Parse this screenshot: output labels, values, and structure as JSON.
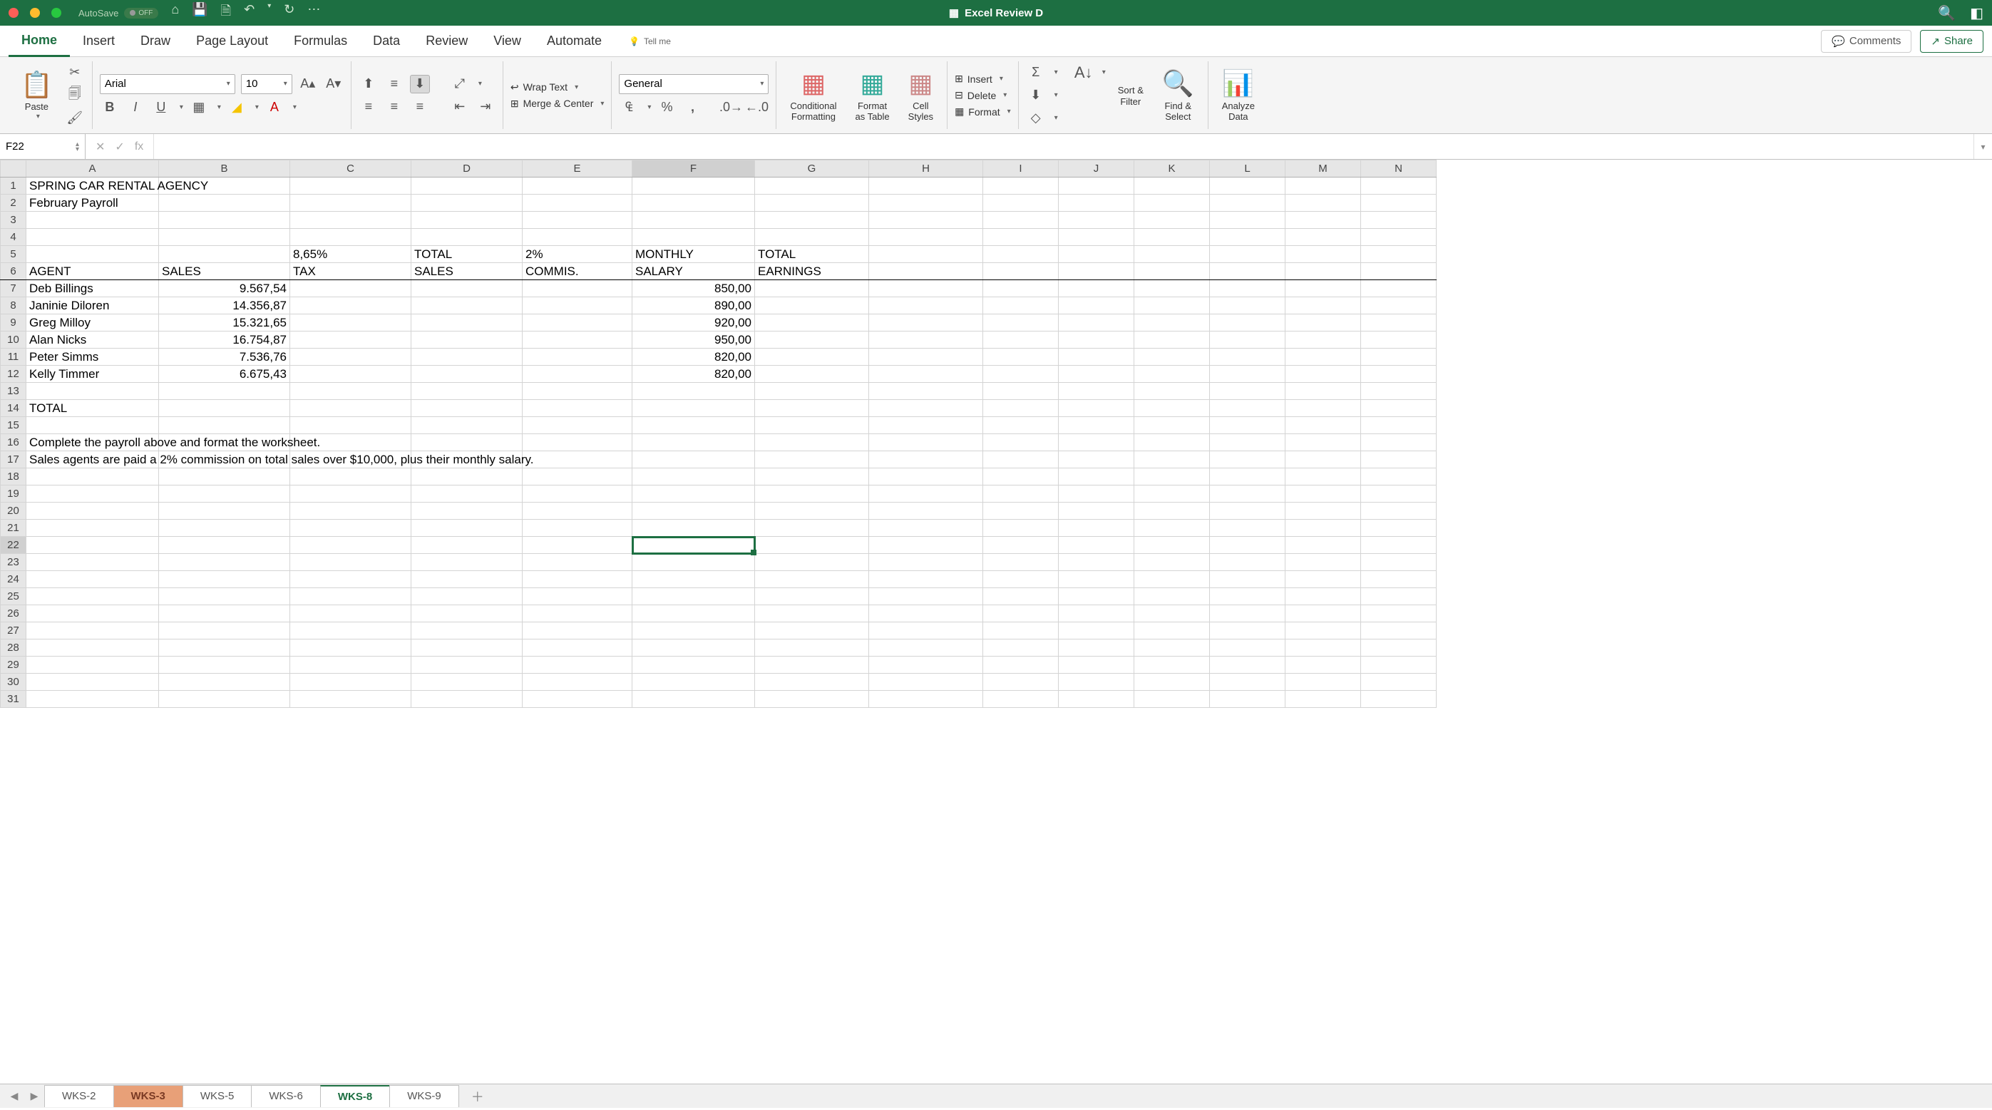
{
  "titlebar": {
    "autosave_label": "AutoSave",
    "autosave_state": "OFF",
    "doc_title": "Excel Review D"
  },
  "tabs": {
    "items": [
      "Home",
      "Insert",
      "Draw",
      "Page Layout",
      "Formulas",
      "Data",
      "Review",
      "View",
      "Automate"
    ],
    "active": "Home",
    "tell_me": "Tell me",
    "comments": "Comments",
    "share": "Share"
  },
  "ribbon": {
    "paste": "Paste",
    "font_name": "Arial",
    "font_size": "10",
    "wrap": "Wrap Text",
    "merge": "Merge & Center",
    "number_format": "General",
    "cond": "Conditional\nFormatting",
    "fmt_table": "Format\nas Table",
    "cell_styles": "Cell\nStyles",
    "insert": "Insert",
    "delete": "Delete",
    "format": "Format",
    "sort": "Sort &\nFilter",
    "find": "Find &\nSelect",
    "analyze": "Analyze\nData"
  },
  "fbar": {
    "namebox": "F22",
    "fx": "fx"
  },
  "columns": [
    "A",
    "B",
    "C",
    "D",
    "E",
    "F",
    "G",
    "H",
    "I",
    "J",
    "K",
    "L",
    "M",
    "N"
  ],
  "rows": {
    "1": {
      "A": "SPRING CAR RENTAL AGENCY"
    },
    "2": {
      "A": "February Payroll"
    },
    "5": {
      "C": "8,65%",
      "D": "TOTAL",
      "E": "2%",
      "F": "MONTHLY",
      "G": "TOTAL"
    },
    "6": {
      "A": "AGENT",
      "B": "SALES",
      "C": "TAX",
      "D": "SALES",
      "E": "COMMIS.",
      "F": "SALARY",
      "G": "EARNINGS"
    },
    "7": {
      "A": "Deb Billings",
      "B": "9.567,54",
      "F": "850,00"
    },
    "8": {
      "A": "Janinie Diloren",
      "B": "14.356,87",
      "F": "890,00"
    },
    "9": {
      "A": "Greg Milloy",
      "B": "15.321,65",
      "F": "920,00"
    },
    "10": {
      "A": "Alan Nicks",
      "B": "16.754,87",
      "F": "950,00"
    },
    "11": {
      "A": "Peter Simms",
      "B": "7.536,76",
      "F": "820,00"
    },
    "12": {
      "A": "Kelly Timmer",
      "B": "6.675,43",
      "F": "820,00"
    },
    "14": {
      "A": "TOTAL"
    },
    "16": {
      "A": "Complete the payroll above and format the worksheet."
    },
    "17": {
      "A": "Sales agents are paid a 2% commission on total sales over $10,000, plus their monthly salary."
    }
  },
  "active_cell": {
    "col": "F",
    "row": 22
  },
  "sheets": {
    "tabs": [
      "WKS-2",
      "WKS-3",
      "WKS-5",
      "WKS-6",
      "WKS-8",
      "WKS-9"
    ],
    "active": "WKS-8",
    "highlighted": "WKS-3"
  }
}
